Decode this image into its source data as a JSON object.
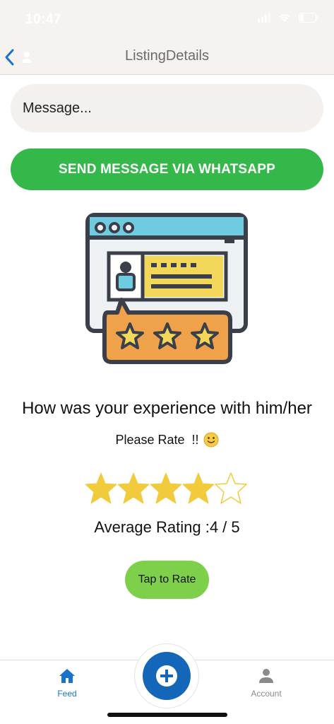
{
  "status_bar": {
    "time": "10:47"
  },
  "nav": {
    "title": "ListingDetails"
  },
  "message": {
    "placeholder": "Message...",
    "value": ""
  },
  "whatsapp_button": {
    "label": "SEND MESSAGE VIA WHATSAPP"
  },
  "rating": {
    "question": "How was your experience with him/her",
    "prompt": "Please Rate  !!",
    "stars_filled": 4,
    "stars_total": 5,
    "average_label": "Average Rating :4 / 5",
    "tap_label": "Tap to Rate"
  },
  "tabs": [
    {
      "label": "Feed",
      "icon": "home-icon",
      "active": true
    },
    {
      "label": "Account",
      "icon": "person-icon",
      "active": false
    }
  ],
  "colors": {
    "accent": "#1a73c8",
    "whatsapp_green": "#35b84a",
    "rate_button": "#7ecf4a",
    "star": "#f2cb3d",
    "fab": "#1467b8"
  }
}
